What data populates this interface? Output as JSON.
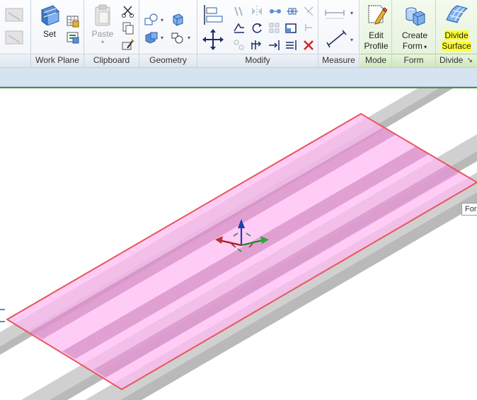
{
  "ribbon": {
    "work_plane": {
      "label": "Work Plane",
      "set": "Set"
    },
    "clipboard": {
      "label": "Clipboard",
      "paste": "Paste"
    },
    "geometry": {
      "label": "Geometry"
    },
    "modify": {
      "label": "Modify"
    },
    "measure": {
      "label": "Measure"
    },
    "mode": {
      "label": "Mode",
      "edit_profile_1": "Edit",
      "edit_profile_2": "Profile"
    },
    "form": {
      "label": "Form",
      "create_form_1": "Create",
      "create_form_2": "Form"
    },
    "divide": {
      "label": "Divide",
      "divide_surface_1": "Divide",
      "divide_surface_2": "Surface"
    }
  },
  "tooltip": "For",
  "colors": {
    "selection_edge": "#e8565b",
    "surface_fill": "#ffb8f2",
    "beam": "#cfcfcf",
    "highlight": "#ffff33",
    "mode_green": "#3c9a3a"
  },
  "icons": [
    "set-work-plane-icon",
    "paste-icon",
    "cut-icon",
    "copy-icon",
    "match-type-icon",
    "join-icon",
    "cope-icon",
    "align-icon",
    "move-icon",
    "rotate-icon",
    "delete-icon",
    "dimension-icon",
    "edit-profile-icon",
    "create-form-icon",
    "divide-surface-icon",
    "gizmo-icon"
  ]
}
